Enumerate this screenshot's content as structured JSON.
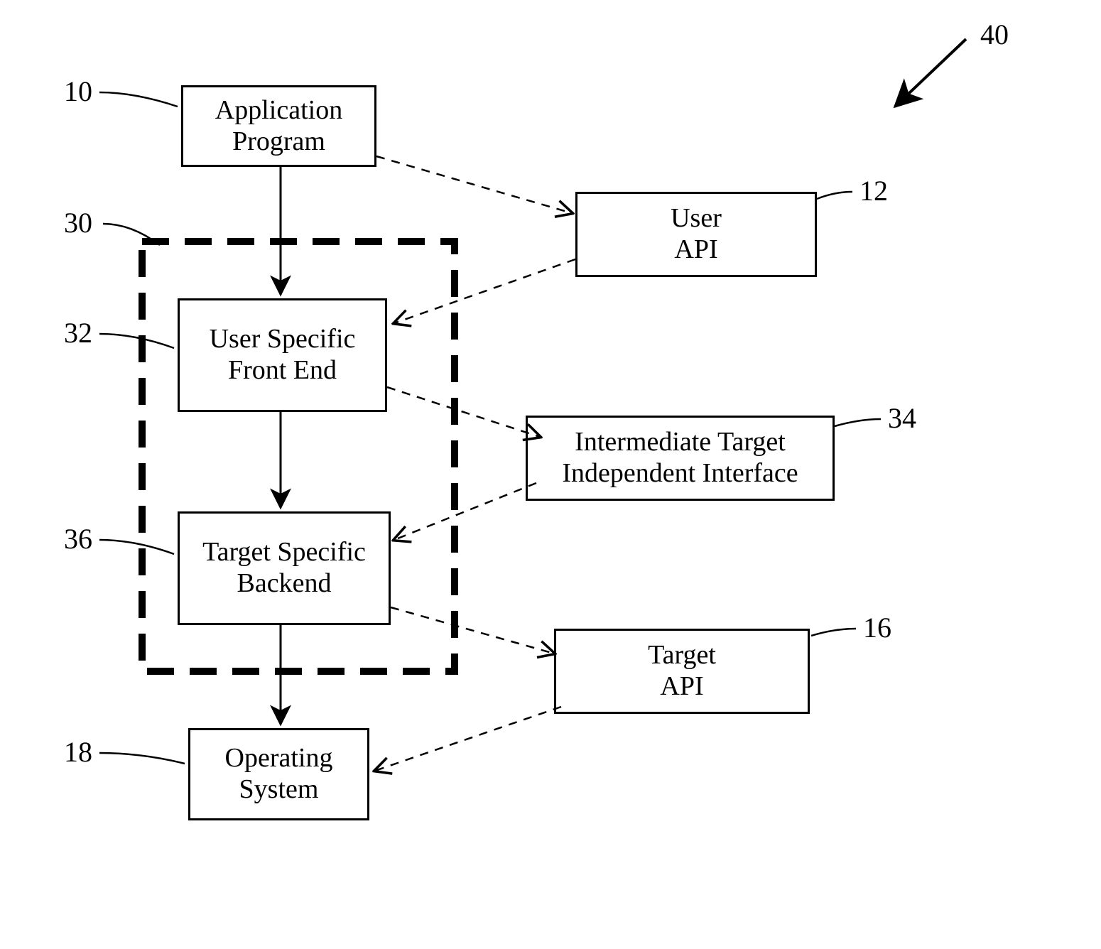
{
  "diagram": {
    "figure_ref": "40",
    "boxes": {
      "app": {
        "line1": "Application",
        "line2": "Program",
        "ref": "10"
      },
      "userapi": {
        "line1": "User",
        "line2": "API",
        "ref": "12"
      },
      "frontend": {
        "line1": "User Specific",
        "line2": "Front End",
        "ref": "32"
      },
      "iti": {
        "line1": "Intermediate Target",
        "line2": "Independent Interface",
        "ref": "34"
      },
      "backend": {
        "line1": "Target Specific",
        "line2": "Backend",
        "ref": "36"
      },
      "targetapi": {
        "line1": "Target",
        "line2": "API",
        "ref": "16"
      },
      "os": {
        "line1": "Operating",
        "line2": "System",
        "ref": "18"
      }
    },
    "dashed_container_ref": "30"
  }
}
